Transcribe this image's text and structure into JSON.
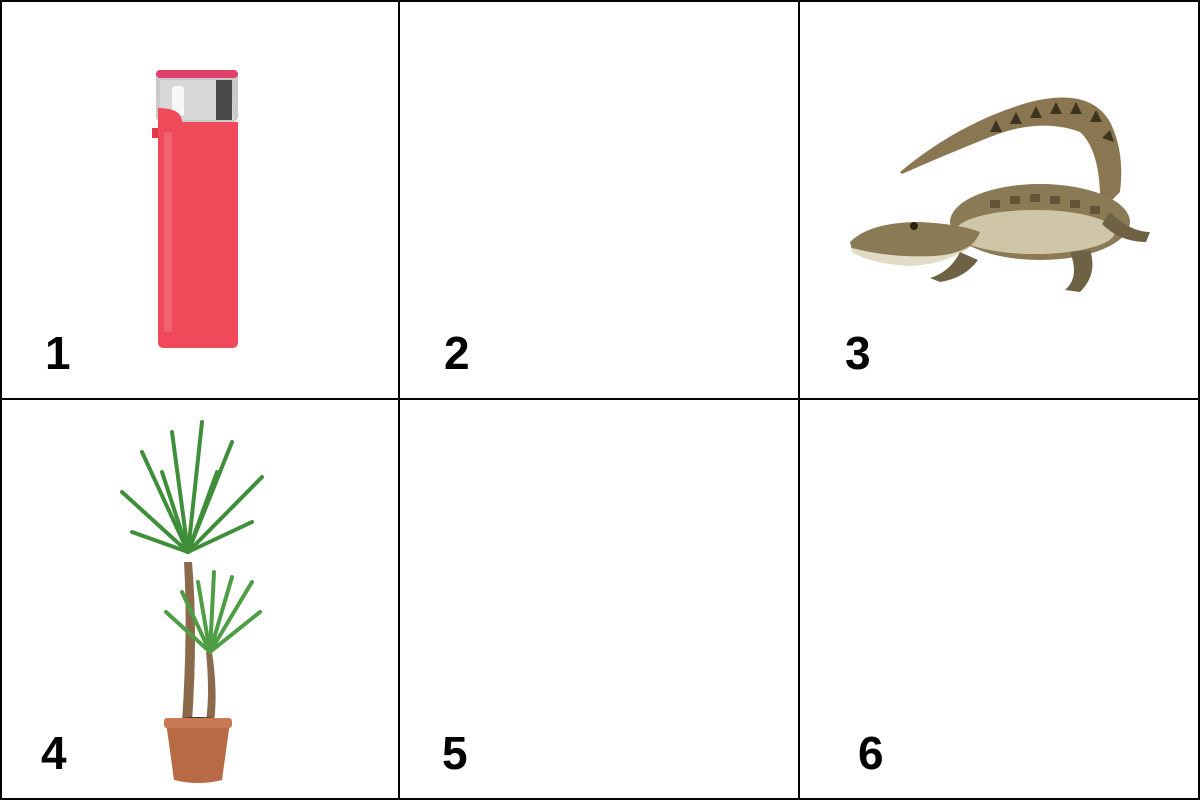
{
  "cells": [
    {
      "label": "1",
      "image": "red-lighter"
    },
    {
      "label": "2",
      "image": ""
    },
    {
      "label": "3",
      "image": "crocodile"
    },
    {
      "label": "4",
      "image": "yucca-plant-in-pot"
    },
    {
      "label": "5",
      "image": ""
    },
    {
      "label": "6",
      "image": ""
    }
  ],
  "colors": {
    "border": "#000000",
    "background": "#ffffff",
    "lighter_body": "#f04a5a",
    "pot": "#b86a45",
    "leaf": "#3f8f3a",
    "croc": "#6b5a3a"
  }
}
